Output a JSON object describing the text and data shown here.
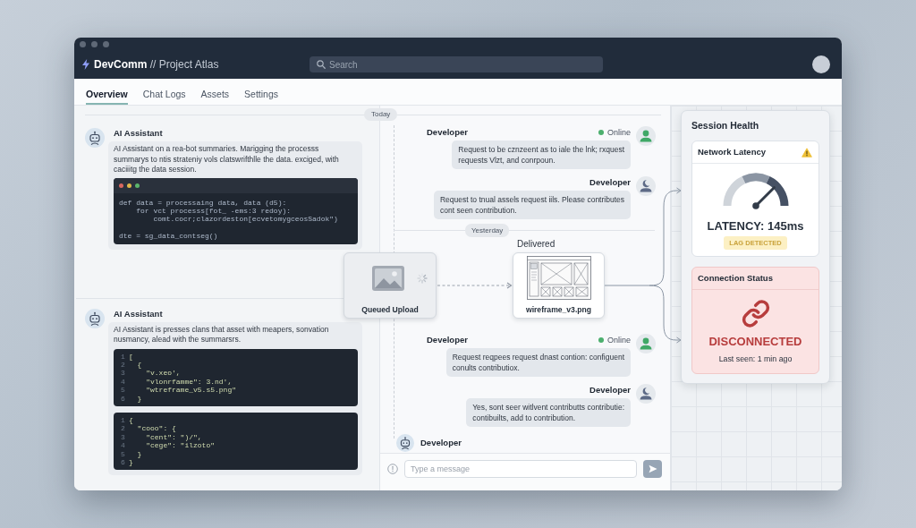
{
  "window": {
    "title": "**DevComm** // Project Atlas"
  },
  "search": {
    "placeholder": "Search"
  },
  "tabs": [
    {
      "label": "Overview",
      "selected": true
    },
    {
      "label": "Chat Logs",
      "selected": false
    },
    {
      "label": "Assets",
      "selected": false
    },
    {
      "label": "Settings",
      "selected": false
    }
  ],
  "timeline": {
    "date_label": "Today"
  },
  "assistant_feed": [
    {
      "author": "AI Assistant",
      "text": "AI Assistant on a rea-bot summaries. Marigging the processs\nsummarys to ntis strateniy vols clatswrifthlle the data. exciged, with\ncaciiitg the data session.",
      "code_blocks": [
        {
          "kind": "editor",
          "code": "def data = processaing data, data (d5):\n    for vct processs[fot_ -ems:3 redoy):\n        comt.cocr;clazordeston[ecvetomygceosSadok\")\n\ndte = sg_data_contseg()"
        }
      ]
    },
    {
      "author": "AI Assistant",
      "text": "AI Assistant is presses clans that asset with meapers, sonvation\nnusmancy, alead with the summarsrs.",
      "code_blocks": [
        {
          "kind": "numbered",
          "lines": [
            {
              "number": "1",
              "code": "["
            },
            {
              "number": "2",
              "code": "  {"
            },
            {
              "number": "3",
              "code": "    \"v.xeo',"
            },
            {
              "number": "4",
              "code": "    \"vlonrfamme\": 3.nd',"
            },
            {
              "number": "5",
              "code": "    \"wtreframe_v5.s5.png\""
            },
            {
              "number": "6",
              "code": "  }"
            }
          ]
        },
        {
          "kind": "numbered",
          "lines": [
            {
              "number": "1",
              "code": "{"
            },
            {
              "number": "2",
              "code": "  \"cooo\": {"
            },
            {
              "number": "3",
              "code": "    \"cent\": \")/\","
            },
            {
              "number": "4",
              "code": "    \"cege\": \"ilzoto\""
            },
            {
              "number": "5",
              "code": "  }"
            },
            {
              "number": "6",
              "code": "}"
            }
          ]
        }
      ]
    }
  ],
  "thread": [
    {
      "kind": "message",
      "author": "Developer",
      "online": true,
      "status": "Online",
      "text": "Request to be cznzeent as to iale the lnk; rxquest\nrequests Vlzt, and conrpoun."
    },
    {
      "kind": "message",
      "author": "Developer",
      "online": false,
      "text": "Request to tnual assels request iils. Please contributes\ncont seen contribution."
    },
    {
      "kind": "separator",
      "label": "Yesterday"
    },
    {
      "kind": "transfer",
      "status": "Delivered",
      "queued_label": "Queued Upload",
      "file_name": "wireframe_v3.png"
    },
    {
      "kind": "message",
      "author": "Developer",
      "online": true,
      "status": "Online",
      "text": "Request reqpees request dnast contion: configuent\nconults contributiox."
    },
    {
      "kind": "message",
      "author": "Developer",
      "online": false,
      "text": "Yes, sont seer witlvent contributts contributie:\ncontibuilts, add to contribution."
    },
    {
      "kind": "incoming",
      "author": "Developer"
    }
  ],
  "composer": {
    "placeholder": "Type a message"
  },
  "session_health": {
    "title": "Session Health",
    "latency": {
      "title": "Network Latency",
      "warning": true,
      "reading": "LATENCY: 145ms",
      "badge": "LAG DETECTED"
    },
    "connection": {
      "title": "Connection Status",
      "connected": false,
      "status": "DISCONNECTED",
      "last_seen": "Last seen: 1 min ago"
    }
  }
}
